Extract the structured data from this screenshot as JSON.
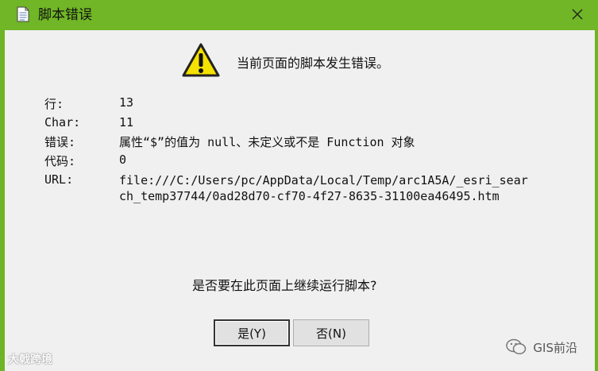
{
  "window": {
    "title": "脚本错误",
    "close_glyph": "✕"
  },
  "message": {
    "headline": "当前页面的脚本发生错误。"
  },
  "details": {
    "line_label": "行:",
    "line_value": "13",
    "char_label": "Char:",
    "char_value": "11",
    "error_label": "错误:",
    "error_value": "属性“$”的值为 null、未定义或不是 Function 对象",
    "code_label": "代码:",
    "code_value": "0",
    "url_label": "URL:",
    "url_value": "file:///C:/Users/pc/AppData/Local/Temp/arc1A5A/_esri_search_temp37744/0ad28d70-cf70-4f27-8635-31100ea46495.htm"
  },
  "prompt": {
    "question": "是否要在此页面上继续运行脚本?"
  },
  "buttons": {
    "yes_label": "是(Y)",
    "no_label": "否(N)"
  },
  "watermarks": {
    "left_text": "大戟跨境",
    "right_text": "GIS前沿"
  },
  "colors": {
    "titlebar": "#70b626",
    "dialog_bg": "#f0f0f0",
    "warning_fill": "#f5e100"
  },
  "icons": {
    "title": "document-icon",
    "close": "close-icon",
    "warning": "warning-icon"
  }
}
